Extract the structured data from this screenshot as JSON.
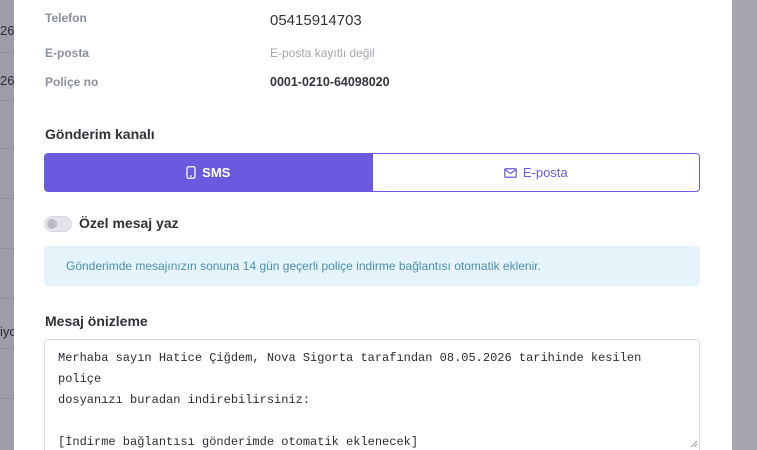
{
  "background": {
    "fragments": [
      "26",
      "26",
      "iyo"
    ]
  },
  "info": {
    "phone_label": "Telefon",
    "phone_value": "05415914703",
    "email_label": "E-posta",
    "email_value": "E-posta kayıtlı değil",
    "policy_label": "Poliçe no",
    "policy_value": "0001-0210-64098020"
  },
  "channel": {
    "title": "Gönderim kanalı",
    "sms_label": "SMS",
    "email_label": "E-posta",
    "selected": "SMS"
  },
  "custom_message": {
    "label": "Özel mesaj yaz",
    "enabled": false
  },
  "notice": {
    "text": "Gönderimde mesajınızın sonuna 14 gün geçerli poliçe indirme bağlantısı otomatik eklenir."
  },
  "preview": {
    "title": "Mesaj önizleme",
    "text": "Merhaba sayın Hatice Çiğdem, Nova Sigorta tarafından 08.05.2026 tarihinde kesilen poliçe\ndosyanızı buradan indirebilirsiniz:\n\n[İndirme bağlantısı gönderimde otomatik eklenecek]"
  },
  "colors": {
    "accent": "#6a5ae0",
    "notice_bg": "#e5f4fa",
    "notice_text": "#4a8fb0"
  }
}
